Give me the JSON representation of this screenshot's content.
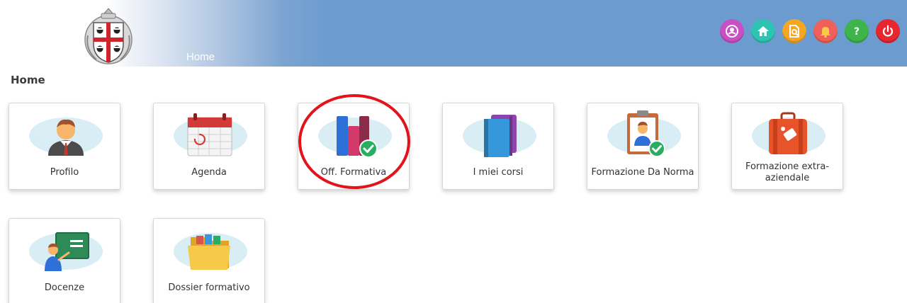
{
  "header": {
    "breadcrumb": "Home",
    "emblem": "sardinia-four-moors-coat-of-arms"
  },
  "top_icons": [
    {
      "name": "accessibility-icon",
      "color": "#c84fc4"
    },
    {
      "name": "home-icon",
      "color": "#2fc3b3"
    },
    {
      "name": "document-search-icon",
      "color": "#f5a623"
    },
    {
      "name": "notification-bell-icon",
      "color": "#f0605b"
    },
    {
      "name": "help-icon",
      "color": "#3db54a"
    },
    {
      "name": "power-icon",
      "color": "#e8262e"
    }
  ],
  "page_title": "Home",
  "tiles": [
    {
      "label": "Profilo",
      "icon": "user-profile-icon"
    },
    {
      "label": "Agenda",
      "icon": "calendar-icon"
    },
    {
      "label": "Off. Formativa",
      "icon": "books-check-icon"
    },
    {
      "label": "I miei corsi",
      "icon": "notebooks-icon"
    },
    {
      "label": "Formazione Da Norma",
      "icon": "clipboard-user-check-icon"
    },
    {
      "label": "Formazione extra-aziendale",
      "icon": "suitcase-icon"
    },
    {
      "label": "Docenze",
      "icon": "teacher-board-icon"
    },
    {
      "label": "Dossier formativo",
      "icon": "folder-icon"
    }
  ],
  "colors": {
    "header_blue": "#6b9bcf",
    "highlight_circle": "#e3131b"
  }
}
